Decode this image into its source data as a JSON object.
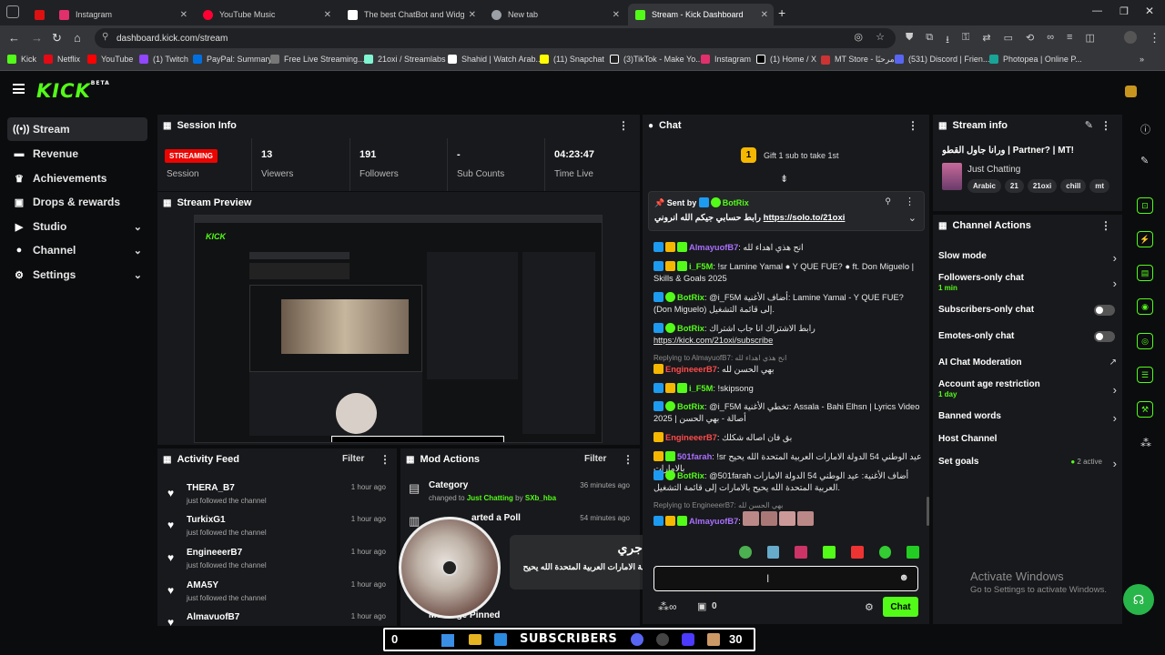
{
  "browser": {
    "tabs": [
      {
        "label": "",
        "color": "#d11"
      },
      {
        "label": "Instagram",
        "color": "#e1306c"
      },
      {
        "label": "YouTube Music",
        "color": "#ff0033"
      },
      {
        "label": "The best ChatBot and Widg",
        "color": "#ffffff"
      },
      {
        "label": "New tab",
        "color": "#9aa0a6"
      },
      {
        "label": "Stream - Kick Dashboard",
        "color": "#53fc18"
      }
    ],
    "url": "dashboard.kick.com/stream",
    "bookmarks": [
      "Kick",
      "Netflix",
      "YouTube",
      "(1) Twitch",
      "PayPal: Summary",
      "Free Live Streaming...",
      "21oxi / Streamlabs",
      "Shahid | Watch Arab...",
      "(11) Snapchat",
      "(3)TikTok - Make Yo...",
      "Instagram",
      "(1) Home / X",
      "MT Store - مرحبًا",
      "(531) Discord | Frien...",
      "Photopea | Online P..."
    ]
  },
  "kick": {
    "logo": "KICK",
    "logo_sup": "BETA"
  },
  "sidebar": {
    "items": [
      {
        "label": "Stream",
        "icon": "(•)",
        "chev": ""
      },
      {
        "label": "Revenue",
        "icon": "▬",
        "chev": ""
      },
      {
        "label": "Achievements",
        "icon": "🏆",
        "chev": ""
      },
      {
        "label": "Drops & rewards",
        "icon": "🎁",
        "chev": ""
      },
      {
        "label": "Studio",
        "icon": "▶",
        "chev": "⌄"
      },
      {
        "label": "Channel",
        "icon": "👤",
        "chev": "⌄"
      },
      {
        "label": "Settings",
        "icon": "⚙",
        "chev": "⌄"
      }
    ]
  },
  "session": {
    "title": "Session Info",
    "live_badge": "STREAMING",
    "stats": [
      {
        "value": "",
        "label": "Session"
      },
      {
        "value": "13",
        "label": "Viewers"
      },
      {
        "value": "191",
        "label": "Followers"
      },
      {
        "value": "-",
        "label": "Sub Counts"
      },
      {
        "value": "04:23:47",
        "label": "Time Live"
      }
    ]
  },
  "preview": {
    "title": "Stream Preview"
  },
  "activity": {
    "title": "Activity Feed",
    "filter": "Filter",
    "items": [
      {
        "name": "THERA_B7",
        "sub": "just followed the channel",
        "time": "1 hour ago"
      },
      {
        "name": "TurkixG1",
        "sub": "just followed the channel",
        "time": "1 hour ago"
      },
      {
        "name": "EngineeerB7",
        "sub": "just followed the channel",
        "time": "1 hour ago"
      },
      {
        "name": "AMA5Y",
        "sub": "just followed the channel",
        "time": "1 hour ago"
      },
      {
        "name": "AlmavuofB7",
        "sub": "",
        "time": "1 hour ago"
      }
    ]
  },
  "mod": {
    "title": "Mod Actions",
    "filter": "Filter",
    "items": [
      {
        "title": "Category",
        "sub_pre": "changed to",
        "sub_hl": "Just Chatting",
        "sub_by": "by",
        "sub_user": "SXb_hba",
        "time": "36 minutes ago"
      },
      {
        "title": "arted a Poll",
        "time": "54 minutes ago"
      },
      {
        "title": "Message Pinned",
        "time": ""
      }
    ]
  },
  "chat": {
    "title": "Chat",
    "gift_count": "1",
    "gift_text": "Gift 1 sub to take 1st",
    "pinned_label": "Sent by",
    "pinned_user": "BotRix",
    "pinned_text": "رابط حسابي جيكم الله انروني",
    "pinned_link": "https://solo.to/21oxi",
    "messages": [
      {
        "user": "AlmayuofB7",
        "color": "#a970ff",
        "text": "انح هذي اهداء لله"
      },
      {
        "user": "i_F5M",
        "color": "#53fc18",
        "text": "!sr Lamine Yamal ● Y QUE FUE? ● ft. Don Miguelo | Skills & Goals 2025"
      },
      {
        "user": "BotRix",
        "color": "#53fc18",
        "text": "@i_F5M أضاف الأغنية: Lamine Yamal - Y QUE FUE? (Don Miguelo) إلى قائمة التشغيل."
      },
      {
        "user": "BotRix",
        "color": "#53fc18",
        "text": "رابط الاشتراك انا جاب اشتراك",
        "link": "https://kick.com/21oxi/subscribe"
      },
      {
        "reply": "Replying to AlmayuofB7: انح هذي اهداء لله",
        "user": "EngineeerB7",
        "color": "#ff4b4b",
        "text": "بهي الحسن لله"
      },
      {
        "user": "i_F5M",
        "color": "#53fc18",
        "text": "!skipsong"
      },
      {
        "user": "BotRix",
        "color": "#53fc18",
        "text": "@i_F5M تخطي الأغنية: Assala - Bahi Elhsn | Lyrics Video 2025 | أصالة - بهي الحسن"
      },
      {
        "user": "EngineeerB7",
        "color": "#ff4b4b",
        "text": "بق فان اصاله شكلك"
      },
      {
        "user": "501farah",
        "color": "#a970ff",
        "text": "!sr عيد الوطني 54 الدولة الامارات العربية المتحدة الله يحيح بالامارات"
      },
      {
        "user": "BotRix",
        "color": "#53fc18",
        "text": "@501farah أضاف الأغنية: عيد الوطني 54 الدولة الامارات العربية المتحدة الله يحيح بالامارات إلى قائمة التشغيل."
      },
      {
        "reply": "Replying to EngineeerB7: بهي الحسن لله",
        "user": "AlmayuofB7",
        "color": "#a970ff",
        "text": ""
      }
    ],
    "input_placeholder": "",
    "footer_count": "0",
    "send": "Chat"
  },
  "song_popup": {
    "artist": "Alhajeri ألهاجري",
    "title": "عيد الوطني 54 الدولة الامارات العربية المتحدة الله يحيح بالامارات"
  },
  "stream_info": {
    "title": "Stream info",
    "stream_title": "ورانا جاول القطو | Partner? | MT!",
    "category": "Just Chatting",
    "tags": [
      "Arabic",
      "21",
      "21oxi",
      "chill",
      "mt"
    ]
  },
  "channel_actions": {
    "title": "Channel Actions",
    "items": [
      {
        "label": "Slow mode",
        "sub": "",
        "control": "chevron"
      },
      {
        "label": "Followers-only chat",
        "sub": "1 min",
        "control": "chevron"
      },
      {
        "label": "Subscribers-only chat",
        "sub": "",
        "control": "toggle"
      },
      {
        "label": "Emotes-only chat",
        "sub": "",
        "control": "toggle"
      },
      {
        "label": "AI Chat Moderation",
        "sub": "",
        "control": "external"
      },
      {
        "label": "Account age restriction",
        "sub": "1 day",
        "control": "chevron"
      },
      {
        "label": "Banned words",
        "sub": "",
        "control": "chevron"
      },
      {
        "label": "Host Channel",
        "sub": "",
        "control": "none"
      },
      {
        "label": "Set goals",
        "sub": "",
        "control": "chevron",
        "status": "2 active"
      }
    ]
  },
  "windows": {
    "activate_title": "Activate Windows",
    "activate_sub": "Go to Settings to activate Windows."
  },
  "overlay": {
    "left_count": "0",
    "label": "SUBSCRIBERS",
    "right_count": "30"
  },
  "colors": {
    "accent": "#53fc18",
    "live": "#eb0400",
    "panel": "#18191c",
    "bg": "#0b0c0e"
  }
}
